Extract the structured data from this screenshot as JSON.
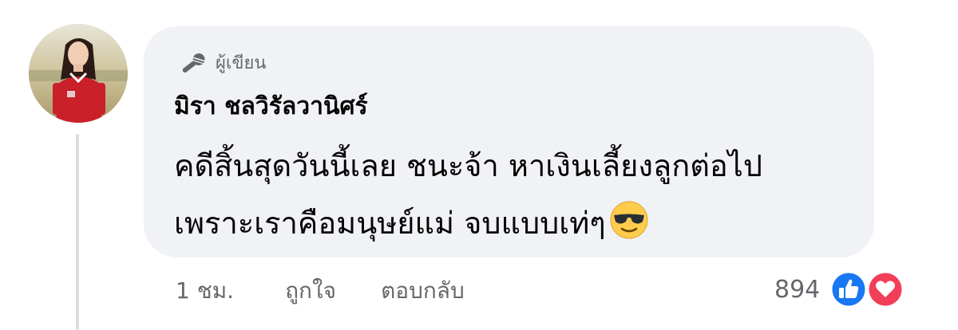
{
  "comment": {
    "author_badge": "ผู้เขียน",
    "author_name": "มิรา ชลวิรัลวานิศร์",
    "text_lines": [
      "คดีสิ้นสุดวันนี้เลย ชนะจ้า หาเงินเลี้ยงลูกต่อไป",
      "เพราะเราคือมนุษย์แม่ จบแบบเท่ๆ"
    ],
    "emoji": "smiling-face-with-sunglasses"
  },
  "actions": {
    "time": "1 ชม.",
    "like_label": "ถูกใจ",
    "reply_label": "ตอบกลับ"
  },
  "reactions": {
    "count": "894",
    "types": [
      "like",
      "love"
    ],
    "like_color": "#1877f2",
    "love_color": "#f33e58"
  },
  "colors": {
    "bubble": "#f0f2f5",
    "secondary_text": "#65676b",
    "primary_text": "#050505"
  }
}
